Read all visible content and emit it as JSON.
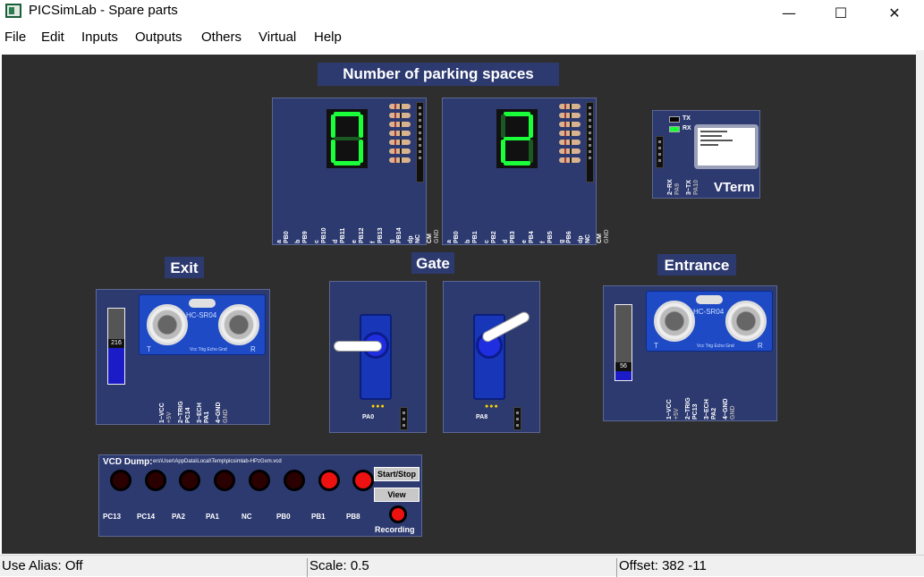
{
  "window": {
    "title": "PICSimLab - Spare parts",
    "minimize_glyph": "—",
    "maximize_glyph": "☐",
    "close_glyph": "✕"
  },
  "menu": {
    "items": [
      "File",
      "Edit",
      "Inputs",
      "Outputs",
      "Others",
      "Virtual",
      "Help"
    ]
  },
  "labels": {
    "parking": "Number of parking spaces",
    "exit": "Exit",
    "gate": "Gate",
    "entrance": "Entrance"
  },
  "display1": {
    "pins": [
      "a",
      "PB0",
      "b",
      "PB9",
      "c",
      "PB10",
      "d",
      "PB11",
      "e",
      "PB12",
      "f",
      "PB13",
      "g",
      "PB14",
      "dp",
      "NC",
      "CM",
      "GND"
    ]
  },
  "display2": {
    "pins": [
      "a",
      "PB0",
      "b",
      "PB1",
      "c",
      "PB2",
      "d",
      "PB3",
      "e",
      "PB4",
      "f",
      "PB5",
      "g",
      "PB6",
      "dp",
      "NC",
      "CM",
      "GND"
    ]
  },
  "vterm": {
    "tx_label": "TX",
    "rx_label": "RX",
    "pin_rx": "2~RX",
    "pin_rx_port": "PA9",
    "pin_tx": "3~TX",
    "pin_tx_port": "PA10",
    "name": "VTerm"
  },
  "sonar_exit": {
    "module": "HC-SR04",
    "slider_value": "216",
    "slider_level": 0.55,
    "pins": [
      "1~VCC",
      "+5V",
      "2~TRIG",
      "PC14",
      "3~ECH",
      "PA1",
      "4~GND",
      "GND"
    ],
    "t_label": "T",
    "r_label": "R",
    "mini_pins": "Vcc Trig Echo Gnd"
  },
  "sonar_entrance": {
    "module": "HC-SR04",
    "slider_value": "56",
    "slider_level": 0.12,
    "pins": [
      "1~VCC",
      "+5V",
      "2~TRIG",
      "PC13",
      "3~ECH",
      "PA2",
      "4~GND",
      "GND"
    ],
    "t_label": "T",
    "r_label": "R",
    "mini_pins": "Vcc Trig Echo Gnd"
  },
  "servo1": {
    "pin": "PA0"
  },
  "servo2": {
    "pin": "PA8"
  },
  "vcd": {
    "title": "VCD Dump:",
    "path": "ers\\User\\AppData\\Local\\Temp\\picsimlab-HPzGxm.vcd",
    "channels": [
      "PC13",
      "PC14",
      "PA2",
      "PA1",
      "NC",
      "PB0",
      "PB1",
      "PB8"
    ],
    "states": [
      false,
      false,
      false,
      false,
      false,
      false,
      true,
      true
    ],
    "start_stop": "Start/Stop",
    "view": "View",
    "recording": "Recording"
  },
  "status": {
    "alias": "Use Alias: Off",
    "scale": "Scale: 0.5",
    "offset": "Offset: 382 -11"
  },
  "colors": {
    "board": "#2d3a70",
    "canvas": "#2e2e2e",
    "segment_on": "#1aff3a",
    "led_on": "#ee1111"
  }
}
